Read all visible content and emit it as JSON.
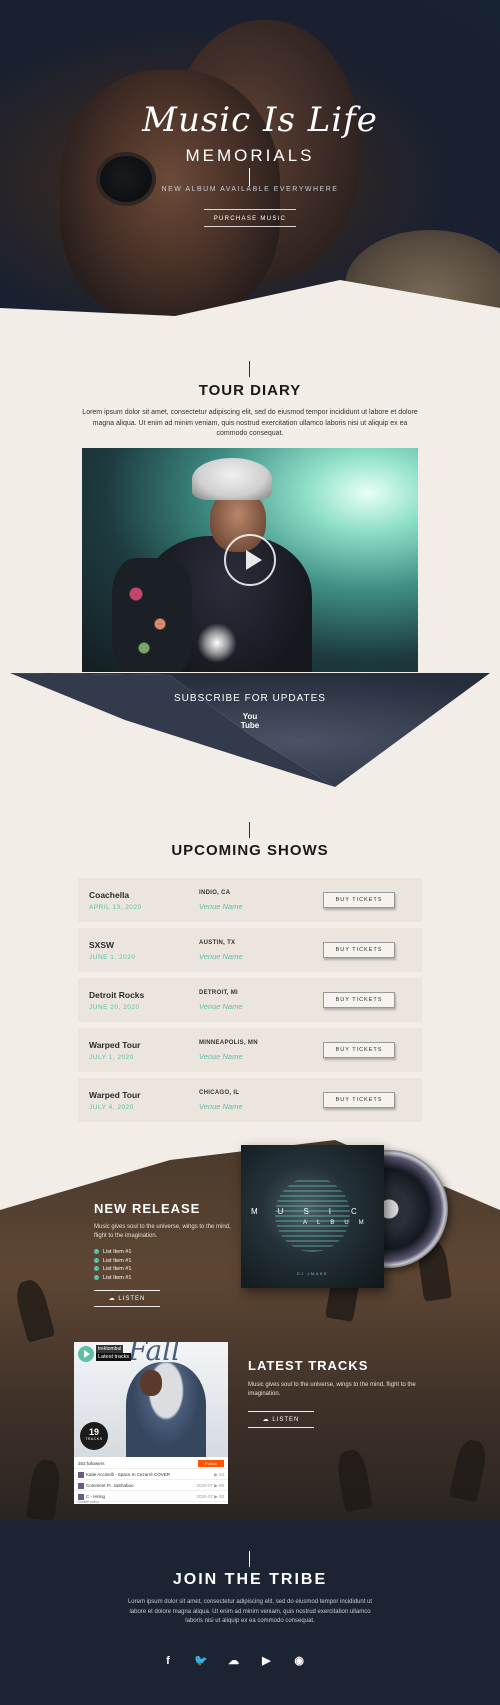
{
  "hero": {
    "title": "Music Is Life",
    "subtitle": "MEMORIALS",
    "tagline": "NEW ALBUM AVAILABLE EVERYWHERE",
    "button": "PURCHASE MUSIC"
  },
  "tour": {
    "title": "TOUR DIARY",
    "text": "Lorem ipsum dolor sit amet, consectetur adipiscing elit, sed do eiusmod tempor incididunt ut labore et dolore magna aliqua. Ut enim ad minim veniam, quis nostrud exercitation ullamco laboris nisi ut aliquip ex ea commodo consequat.",
    "subscribe": "SUBSCRIBE FOR UPDATES",
    "youtube_label_1": "You",
    "youtube_label_2": "Tube"
  },
  "shows": {
    "title": "UPCOMING SHOWS",
    "items": [
      {
        "name": "Coachella",
        "date": "APRIL 13, 2020",
        "city": "INDIO, CA",
        "venue": "Venue Name",
        "button": "BUY TICKETS"
      },
      {
        "name": "SXSW",
        "date": "JUNE 1, 2020",
        "city": "AUSTIN, TX",
        "venue": "Venue Name",
        "button": "BUY TICKETS"
      },
      {
        "name": "Detroit Rocks",
        "date": "JUNE 20, 2020",
        "city": "DETROIT, MI",
        "venue": "Venue Name",
        "button": "BUY TICKETS"
      },
      {
        "name": "Warped Tour",
        "date": "JULY 1, 2020",
        "city": "MINNEAPOLIS, MN",
        "venue": "Venue Name",
        "button": "BUY TICKETS"
      },
      {
        "name": "Warped Tour",
        "date": "JULY 4, 2020",
        "city": "CHICAGO, IL",
        "venue": "Venue Name",
        "button": "BUY TICKETS"
      }
    ]
  },
  "release": {
    "title": "NEW RELEASE",
    "text": "Music gives soul to the universe, wings to the mind, flight to the imagination.",
    "list": [
      "List Item #1",
      "List Item #1",
      "List Item #1",
      "List Item #1"
    ],
    "button": "LISTEN",
    "album_word_1": "MUSIC",
    "album_word_2": "ALBUM",
    "album_artist": "DJ JMAKE"
  },
  "tracks": {
    "title": "LATEST TRACKS",
    "text": "Music gives soul to the universe, wings to the mind, flight to the imagination.",
    "button": "LISTEN",
    "player": {
      "cover_word": "Fall",
      "label_1": "trektombul",
      "label_2": "Latest tracks",
      "count": "19",
      "count_label": "TRACKS",
      "followers": "353 followers",
      "follow_button": "Follow",
      "rows": [
        {
          "title": "Katie Accinelli - Space In Cezarré COVER",
          "meta": "▶ 54"
        },
        {
          "title": "Comment Fr. JaShaboo",
          "meta": "2020-07 ▶ 88"
        },
        {
          "title": "C - Hiring",
          "meta": "2020-07 ▶ 53"
        }
      ],
      "footer": "Cookie policy"
    }
  },
  "tribe": {
    "title": "JOIN THE TRIBE",
    "text": "Lorem ipsum dolor sit amet, consectetur adipiscing elit, sed do eiusmod tempor incididunt ut labore et dolore magna aliqua. Ut enim ad minim veniam, quis nostrud exercitation ullamco laboris nisi ut aliquip ex ea commodo consequat.",
    "socials": [
      {
        "icon": "facebook-icon",
        "glyph": "f"
      },
      {
        "icon": "twitter-icon",
        "glyph": "🐦"
      },
      {
        "icon": "soundcloud-icon",
        "glyph": "☁"
      },
      {
        "icon": "youtube-icon",
        "glyph": "▶"
      },
      {
        "icon": "spotify-icon",
        "glyph": "◉"
      },
      {
        "icon": "apple-icon",
        "glyph": ""
      }
    ]
  },
  "colors": {
    "accent": "#5cbfa7",
    "navy": "#1c2333",
    "cream": "#f2ede7"
  }
}
